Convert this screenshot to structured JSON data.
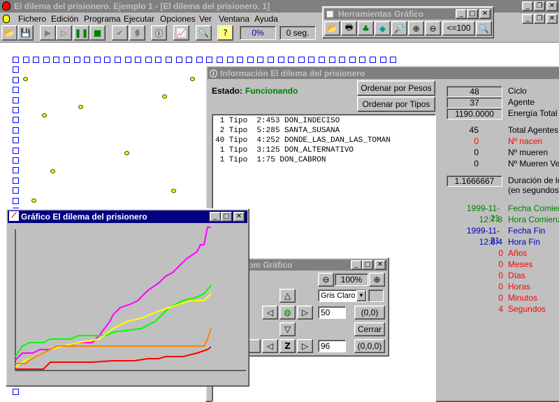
{
  "app": {
    "title": "El dilema del prisionero. Ejemplo 1 - [El dilema del prisionero. 1]",
    "menu": [
      "Fichero",
      "Edición",
      "Programa",
      "Ejecutar",
      "Opciones",
      "Ver",
      "Ventana",
      "Ayuda"
    ],
    "toolbar": {
      "progress": "0%",
      "time": "0 seg."
    }
  },
  "herramientas": {
    "title": "Herramientas Gráfico",
    "limit_label": "<=100"
  },
  "info": {
    "title": "Información El dilema del prisionero",
    "estado_label": "Estado:",
    "estado_value": "Funcionando",
    "btn_pesos": "Ordenar por Pesos",
    "btn_tipos": "Ordenar por Tipos",
    "list": [
      " 1 Tipo  2:453 DON_INDECISO",
      " 2 Tipo  5:285 SANTA_SUSANA",
      "40 Tipo  4:252 DONDE_LAS_DAN_LAS_TOMAN",
      " 1 Tipo  3:125 DON_ALTERNATIVO",
      " 1 Tipo  1:75 DON_CABRON"
    ],
    "stats": {
      "ciclo": "48",
      "ciclo_label": "Ciclo",
      "agente": "37",
      "agente_label": "Agente",
      "energia": "1190.0000",
      "energia_label": "Energía Total",
      "total_agentes": "45",
      "total_agentes_label": "Total Agentes",
      "nacen": "0",
      "nacen_label": "Nº nacen",
      "mueren": "0",
      "mueren_label": "Nº mueren",
      "mueren_vejez": "0",
      "mueren_vejez_label": "Nº Mueren Vejez",
      "duracion": "1.1666667",
      "duracion_label": "Duración de los",
      "duracion_label2": "(en segundos)",
      "fecha_comienzo": "1999-11-21",
      "fecha_comienzo_label": "Fecha Comienzo",
      "hora_comienzo": "12:7:8",
      "hora_comienzo_label": "Hora Comienzo",
      "fecha_fin": "1999-11-21",
      "fecha_fin_label": "Fecha Fin",
      "hora_fin": "12:8:4",
      "hora_fin_label": "Hora Fin",
      "anos": "0",
      "anos_label": "Años",
      "meses": "0",
      "meses_label": "Meses",
      "dias": "0",
      "dias_label": "Días",
      "horas": "0",
      "horas_label": "Horas",
      "minutos": "0",
      "minutos_label": "Minutos",
      "segundos": "4",
      "segundos_label": "Segundos"
    }
  },
  "zoom": {
    "title": "om Gráfico",
    "zoom_value": "100%",
    "color": "Gris Claro",
    "field1": "50",
    "coord1": "(0,0)",
    "field2": "96",
    "coord2": "(0,0,0)",
    "z_label": "Z",
    "close_label": "Cerrar"
  },
  "grafico": {
    "title": "Gráfico El dilema del prisionero"
  },
  "colors": {
    "magenta": "#ff00ff",
    "green": "#00ff00",
    "yellow": "#ffff00",
    "orange": "#ff8000",
    "red": "#ff0000"
  }
}
